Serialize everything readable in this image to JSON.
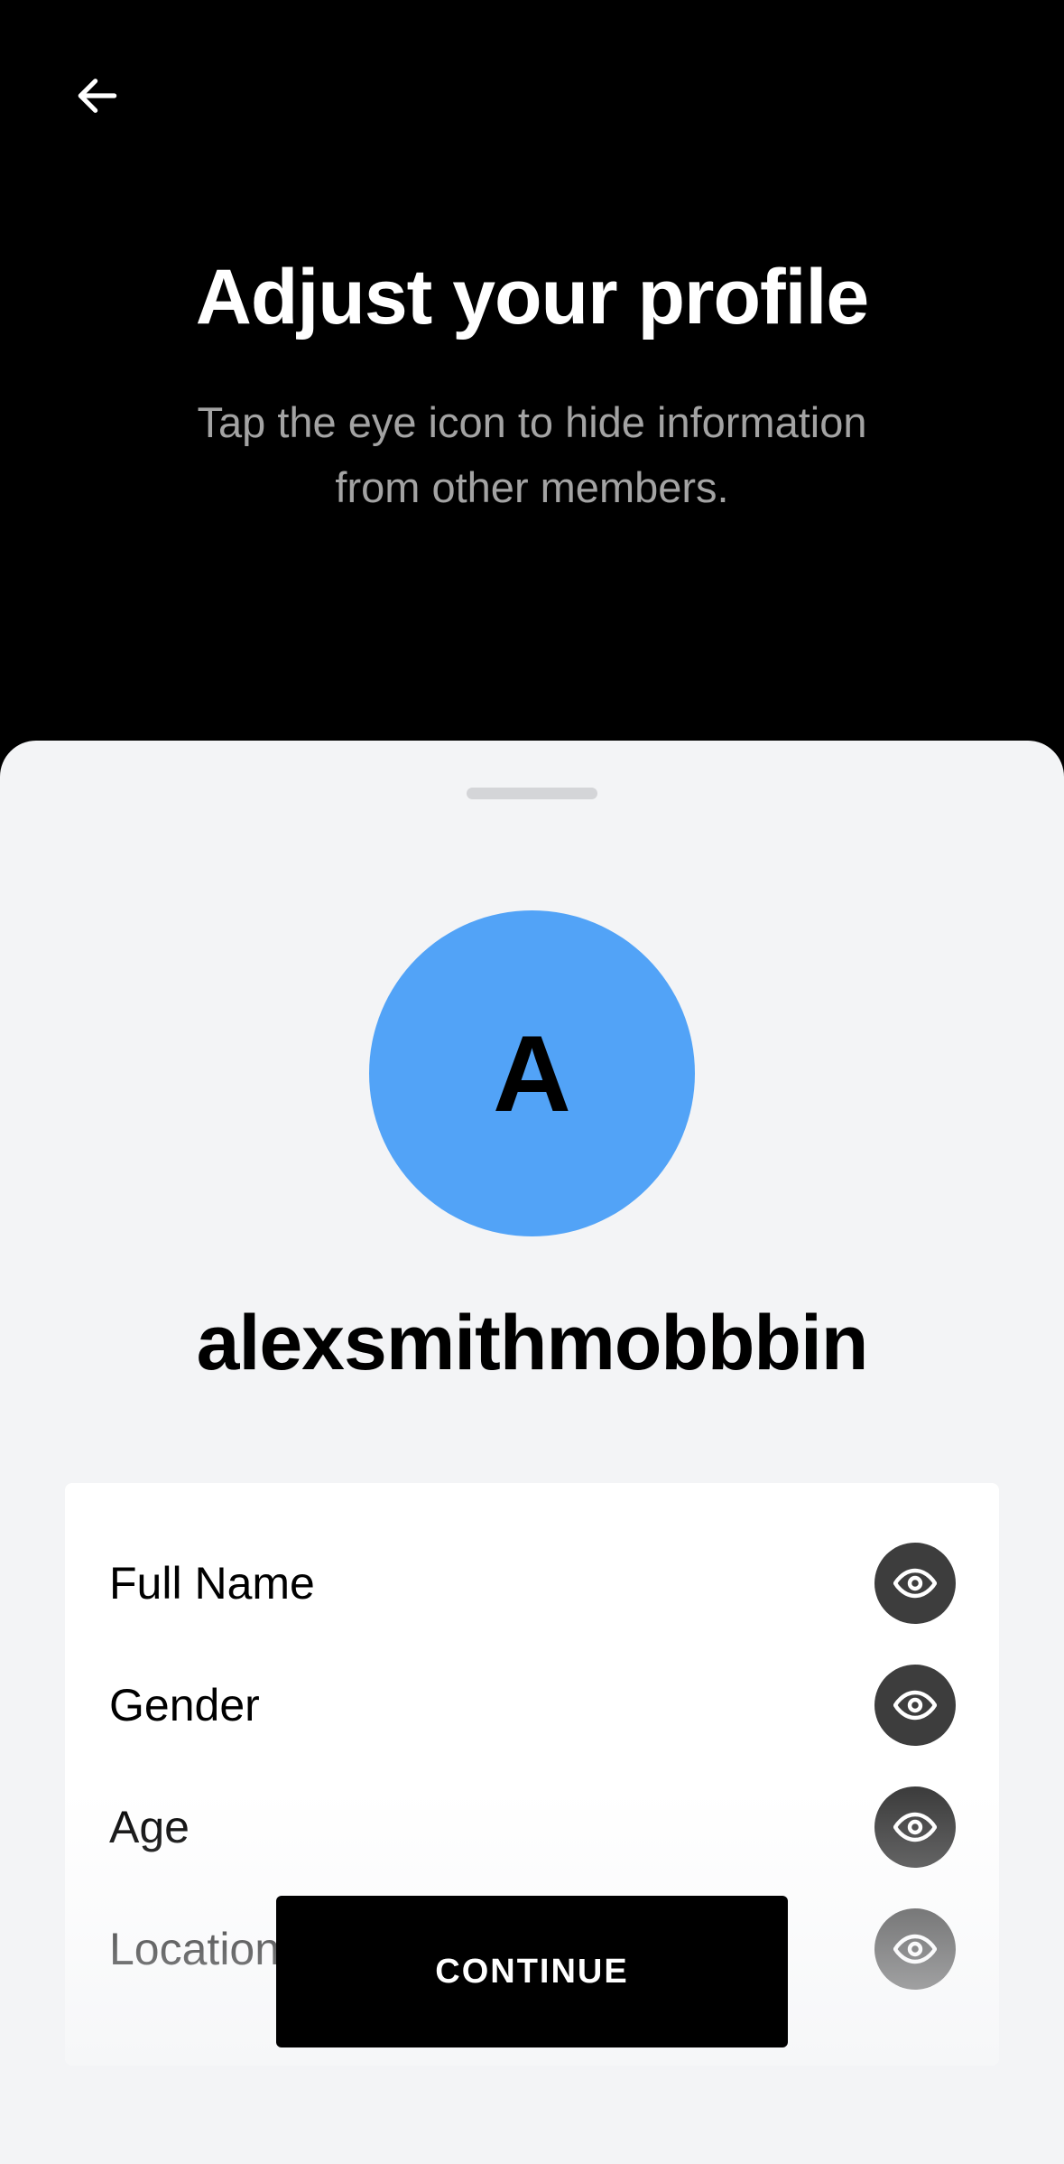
{
  "header": {
    "back_icon": "arrow-left-icon",
    "title": "Adjust your profile",
    "subtitle_line1": "Tap the eye icon to hide information",
    "subtitle_line2": "from other members."
  },
  "profile": {
    "avatar_initial": "A",
    "avatar_color": "#52a3f7",
    "username": "alexsmithmobbbin"
  },
  "fields": [
    {
      "label": "Full Name",
      "icon": "eye-icon"
    },
    {
      "label": "Gender",
      "icon": "eye-icon"
    },
    {
      "label": "Age",
      "icon": "eye-icon"
    },
    {
      "label": "Location",
      "icon": "eye-icon"
    }
  ],
  "actions": {
    "continue_label": "CONTINUE"
  }
}
